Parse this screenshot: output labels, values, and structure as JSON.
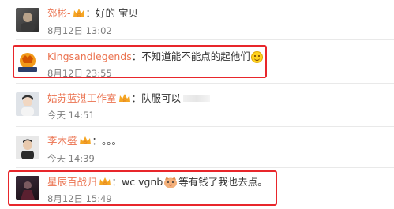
{
  "comments": [
    {
      "username": "郊彬-",
      "text": "好的 宝贝",
      "time": "8月12日 13:02"
    },
    {
      "username": "Kingsandlegends",
      "text": "不知道能不能点的起他们",
      "time": "8月12日 23:55",
      "highlighted": true
    },
    {
      "username": "姑苏蓝湛工作室",
      "text": "队服可以",
      "time": "今天 14:51"
    },
    {
      "username": "李木盛",
      "text": "。。。",
      "time": "今天 14:39"
    },
    {
      "username": "星辰百战归",
      "text_before": "wc vgnb",
      "text_after": "等有钱了我也去点。",
      "time": "8月12日 15:49",
      "highlighted": true
    }
  ],
  "colon": "：",
  "colors": {
    "username": "#eb7350",
    "highlight_box": "#e8262b",
    "timestamp": "#808080"
  }
}
